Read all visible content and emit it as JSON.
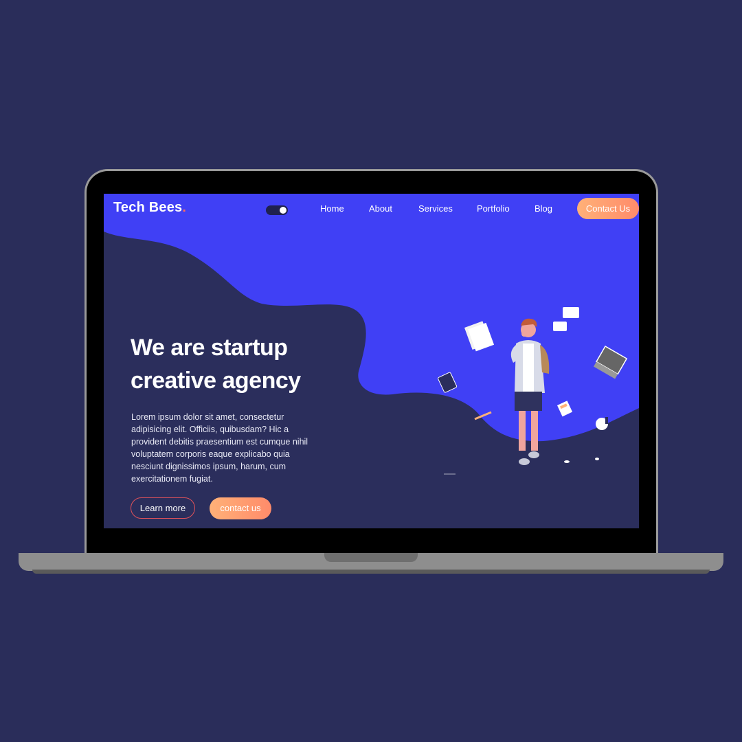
{
  "brand": {
    "name": "Tech Bees",
    "dot": ".",
    "accent": "#ff6a5b"
  },
  "nav": {
    "theme_toggle": "dark-mode-toggle",
    "links": [
      "Home",
      "About",
      "Services",
      "Portfolio",
      "Blog"
    ],
    "cta_label": "Contact Us"
  },
  "hero": {
    "headline_line1": "We are startup",
    "headline_line2": "creative agency",
    "body": "Lorem ipsum dolor sit amet, consectetur adipisicing elit. Officiis, quibusdam? Hic a provident debitis praesentium est cumque nihil voluptatem corporis eaque explicabo quia nesciunt dignissimos ipsum, harum, cum exercitationem fugiat.",
    "primary_button": "Learn more",
    "secondary_button": "contact us",
    "illustration": "person-on-phone-illustration"
  },
  "colors": {
    "page_bg": "#2a2d5a",
    "hero_blue": "#4040f5",
    "hero_dark": "#2b2e5c",
    "button_gradient_start": "#ffb178",
    "button_gradient_end": "#ff8b6a"
  }
}
